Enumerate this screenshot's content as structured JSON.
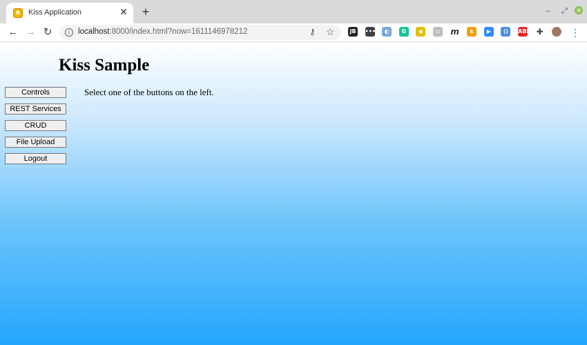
{
  "browser": {
    "tab_title": "Kiss Application",
    "tab_close": "✕",
    "new_tab": "+",
    "url_host": "localhost",
    "url_rest": ":8000/index.html?now=1611146978212",
    "window_controls": {
      "minimize": "–",
      "maximize": "⤢",
      "close": "✕"
    },
    "extensions": [
      {
        "name": "jb-extension",
        "label": "JB",
        "color": "#222222"
      },
      {
        "name": "password-extension",
        "label": "•••",
        "color": "#3b3f45"
      },
      {
        "name": "feather-extension",
        "label": "◐",
        "color": "#7aa7e0"
      },
      {
        "name": "grammarly-extension",
        "label": "G",
        "color": "#15c39a"
      },
      {
        "name": "shield-extension",
        "label": "◆",
        "color": "#e5c000"
      },
      {
        "name": "clipboard-extension",
        "label": "▭",
        "color": "#bdbdbd"
      },
      {
        "name": "m-extension",
        "label": "m",
        "color": "#ffffff"
      },
      {
        "name": "k-extension",
        "label": "k",
        "color": "#f29f05"
      },
      {
        "name": "zoom-extension",
        "label": "▶",
        "color": "#2d8cff"
      },
      {
        "name": "bracket-extension",
        "label": "⟨⟩",
        "color": "#4a90e2"
      },
      {
        "name": "adblock-extension",
        "label": "ABP",
        "color": "#e0292b"
      },
      {
        "name": "puzzle-extension",
        "label": "✚",
        "color": "#444444"
      },
      {
        "name": "profile-avatar",
        "label": "",
        "color": "#a07860"
      }
    ]
  },
  "page": {
    "title": "Kiss Sample",
    "message": "Select one of the buttons on the left.",
    "buttons": [
      "Controls",
      "REST Services",
      "CRUD",
      "File Upload",
      "Logout"
    ]
  }
}
